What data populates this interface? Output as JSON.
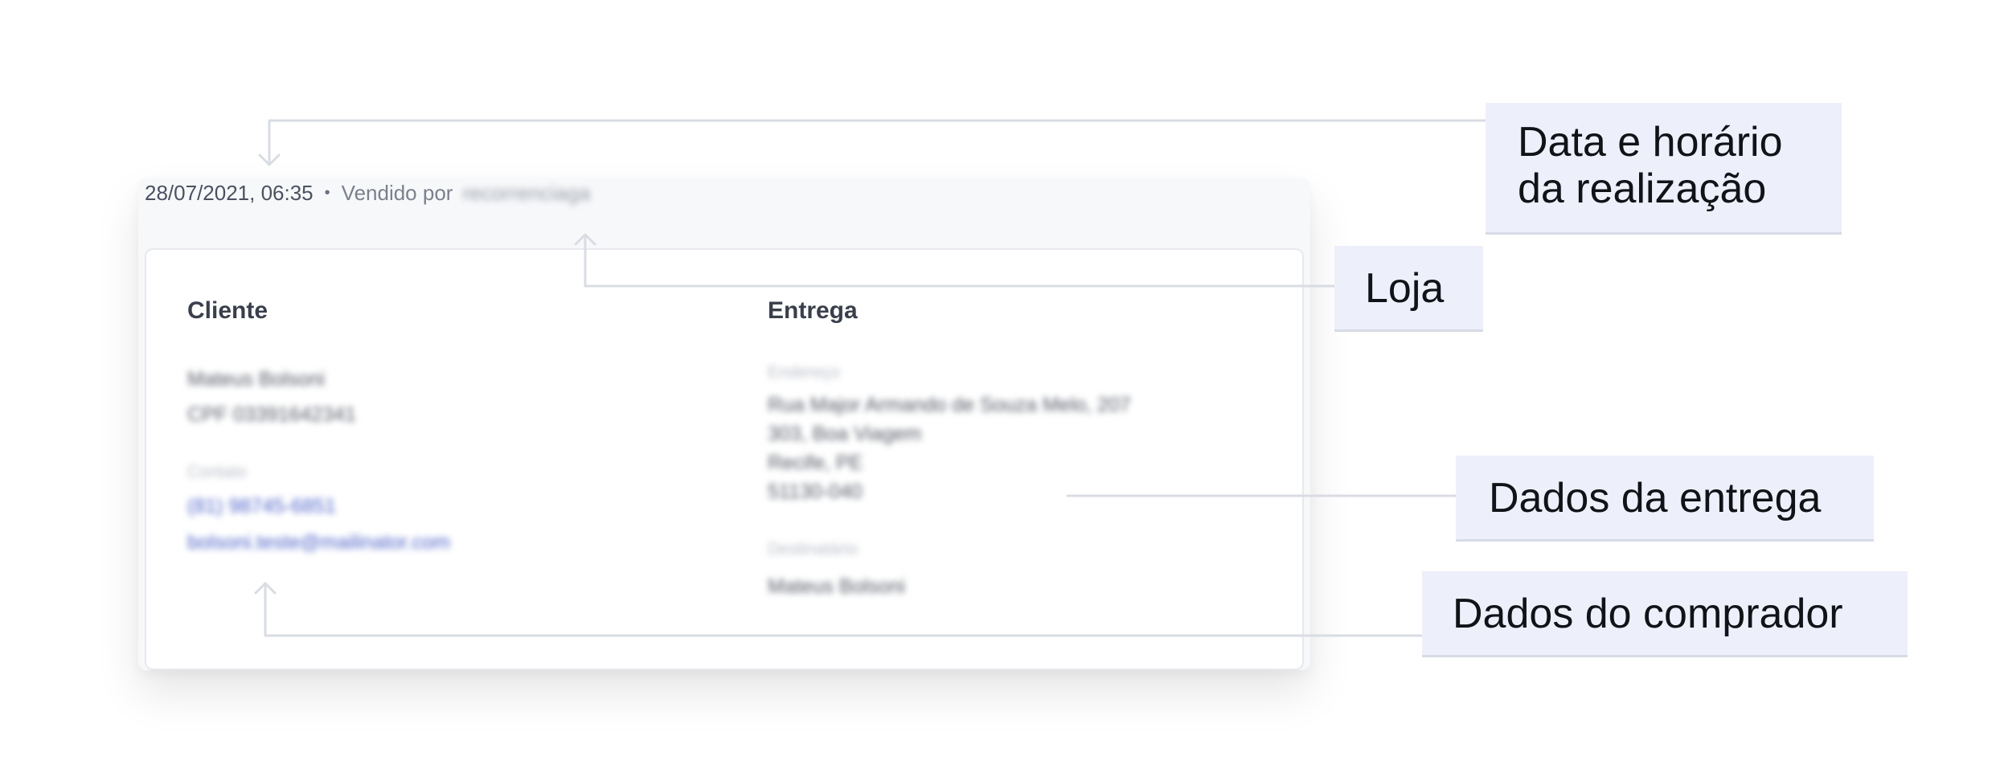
{
  "order": {
    "datetime": "28/07/2021, 06:35",
    "separator": "•",
    "sold_by_prefix": "Vendido por",
    "store_name": "recorrenciaga",
    "client": {
      "title": "Cliente",
      "name": "Mateus Bolsoni",
      "document": "CPF 03391642341",
      "contact_caption": "Contato",
      "phone": "(81) 98745-6851",
      "email": "bolsoni.teste@mailinator.com"
    },
    "delivery": {
      "title": "Entrega",
      "address_caption": "Endereço",
      "address_lines": [
        "Rua Major Armando de Souza Melo, 207",
        "303, Boa Viagem",
        "Recife, PE",
        "51130-040"
      ],
      "recipient_caption": "Destinatário",
      "recipient_name": "Mateus Bolsoni"
    }
  },
  "annotations": {
    "datetime_label_line1": "Data e horário",
    "datetime_label_line2": "da realização",
    "store_label": "Loja",
    "delivery_label": "Dados da entrega",
    "buyer_label": "Dados do comprador"
  },
  "colors": {
    "label_background": "#edf0fa",
    "connector": "#d9dce3",
    "link": "#4d63c8"
  }
}
